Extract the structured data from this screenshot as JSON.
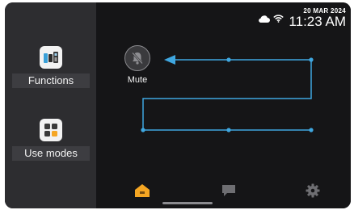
{
  "status": {
    "date": "20 MAR 2024",
    "time": "11:23 AM",
    "icons": [
      "cloud-icon",
      "wifi-icon"
    ]
  },
  "sidebar": {
    "items": [
      {
        "label": "Functions",
        "icon": "intercom-devices-icon"
      },
      {
        "label": "Use modes",
        "icon": "grid-modes-icon"
      }
    ]
  },
  "main": {
    "mute": {
      "label": "Mute",
      "icon": "bell-muted-icon"
    }
  },
  "bottom_nav": {
    "items": [
      {
        "icon": "home-icon",
        "active": true
      },
      {
        "icon": "chat-icon",
        "active": false
      },
      {
        "icon": "gear-icon",
        "active": false
      }
    ]
  },
  "colors": {
    "accent": "#f5a623",
    "route_line": "#3fa7e0",
    "sidebar_bg": "#2d2d30",
    "main_bg": "#151517"
  }
}
